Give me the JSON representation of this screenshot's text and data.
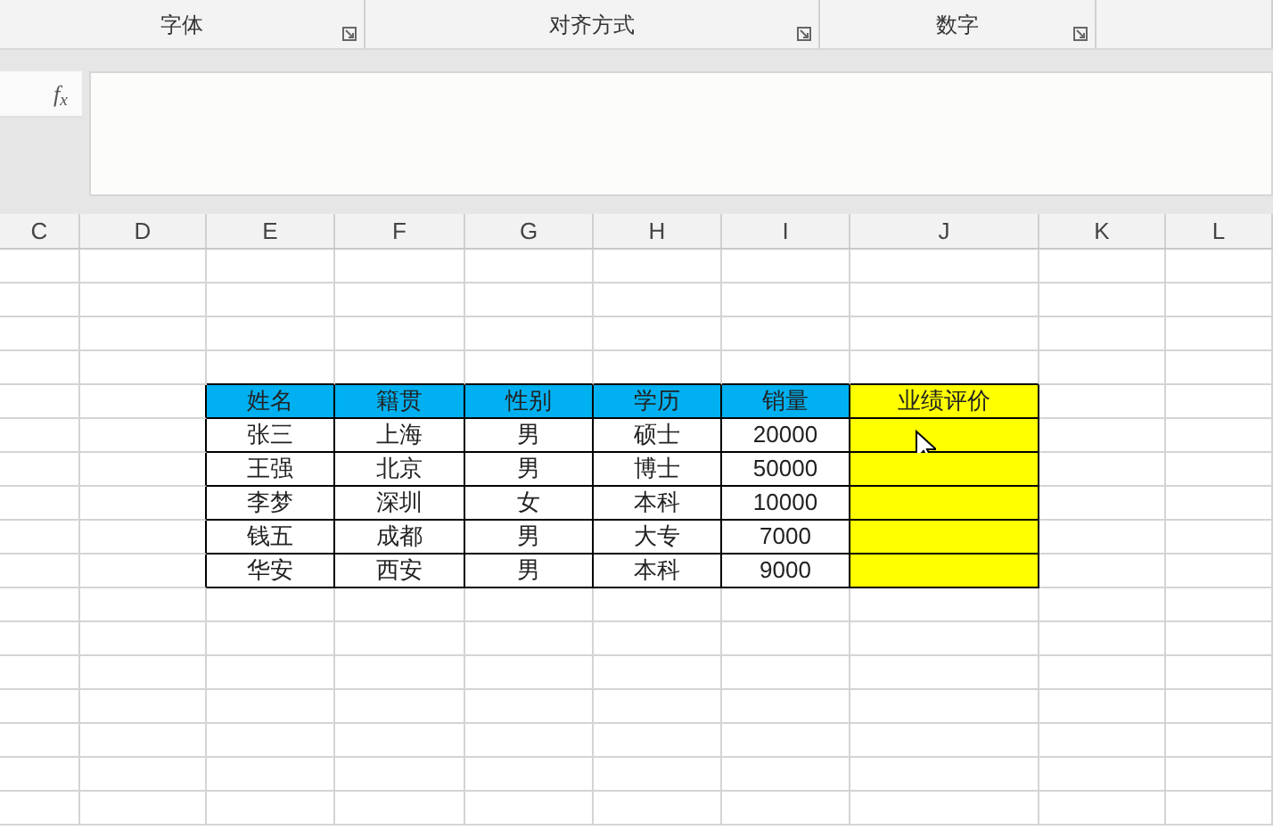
{
  "ribbon": {
    "groups": [
      {
        "label": "字体"
      },
      {
        "label": "对齐方式"
      },
      {
        "label": "数字"
      }
    ]
  },
  "formula_bar": {
    "function_label": "f$_{x}$"
  },
  "column_headers": [
    "C",
    "D",
    "E",
    "F",
    "G",
    "H",
    "I",
    "J",
    "K",
    "L"
  ],
  "table": {
    "columns": [
      {
        "label": "姓名",
        "color": "#00b0f0",
        "kind": "plain"
      },
      {
        "label": "籍贯",
        "color": "#00b0f0",
        "kind": "plain"
      },
      {
        "label": "性别",
        "color": "#00b0f0",
        "kind": "plain"
      },
      {
        "label": "学历",
        "color": "#00b0f0",
        "kind": "plain"
      },
      {
        "label": "销量",
        "color": "#00b0f0",
        "kind": "plain"
      },
      {
        "label": "业绩评价",
        "color": "#ffff00",
        "kind": "highlighted"
      }
    ],
    "rows": [
      [
        "张三",
        "上海",
        "男",
        "硕士",
        "20000"
      ],
      [
        "王强",
        "北京",
        "男",
        "博士",
        "50000"
      ],
      [
        "李梦",
        "深圳",
        "女",
        "本科",
        "10000"
      ],
      [
        "钱五",
        "成都",
        "男",
        "大专",
        "7000"
      ],
      [
        "华安",
        "西安",
        "男",
        "本科",
        "9000"
      ]
    ]
  }
}
